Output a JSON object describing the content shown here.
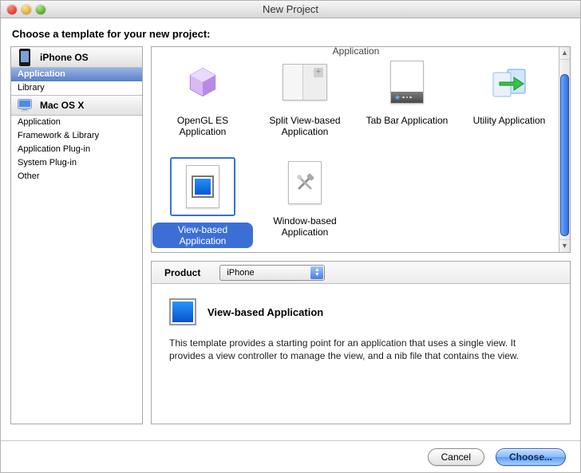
{
  "window": {
    "title": "New Project"
  },
  "prompt": "Choose a template for your new project:",
  "sidebar": {
    "groups": [
      {
        "header": "iPhone OS",
        "icon": "iphone-icon",
        "items": [
          {
            "label": "Application",
            "selected": true
          },
          {
            "label": "Library",
            "selected": false
          }
        ]
      },
      {
        "header": "Mac OS X",
        "icon": "macosx-icon",
        "items": [
          {
            "label": "Application"
          },
          {
            "label": "Framework & Library"
          },
          {
            "label": "Application Plug-in"
          },
          {
            "label": "System Plug-in"
          },
          {
            "label": "Other"
          }
        ]
      }
    ]
  },
  "templates": {
    "partial_above": "Application",
    "items": [
      {
        "label": "OpenGL ES Application",
        "icon": "opengl-cube-icon"
      },
      {
        "label": "Split View-based Application",
        "icon": "split-view-icon"
      },
      {
        "label": "Tab Bar Application",
        "icon": "tab-bar-icon"
      },
      {
        "label": "Utility Application",
        "icon": "utility-arrow-icon"
      },
      {
        "label": "View-based Application",
        "icon": "view-based-icon",
        "selected": true
      },
      {
        "label": "Window-based Application",
        "icon": "window-tools-icon"
      }
    ]
  },
  "product": {
    "label": "Product",
    "selected": "iPhone"
  },
  "detail": {
    "title": "View-based Application",
    "description": "This template provides a starting point for an application that uses a single view. It provides a view controller to manage the view, and a nib file that contains the view."
  },
  "buttons": {
    "cancel": "Cancel",
    "choose": "Choose..."
  }
}
